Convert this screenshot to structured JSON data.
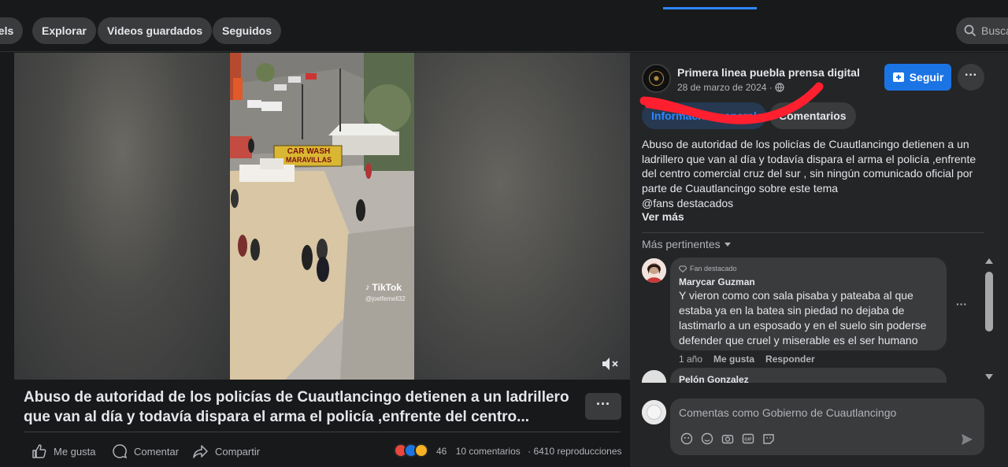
{
  "nav": {
    "tabs": [
      "eels",
      "Explorar",
      "Videos guardados",
      "Seguidos"
    ],
    "search_placeholder": "Busca"
  },
  "video": {
    "overlay": {
      "sign_line1": "CAR WASH",
      "sign_line2": "MARAVILLAS",
      "watermark": "TikTok",
      "watermark_user": "@joelfemell32"
    },
    "title": "Abuso de autoridad de los policías de Cuautlancingo detienen a un ladrillero que van al día y todavía dispara el arma el policía ,enfrente del centro...",
    "more_label": "···",
    "actions": {
      "like": "Me gusta",
      "comment": "Comentar",
      "share": "Compartir"
    },
    "stats": {
      "reactions_count": "46",
      "comments": "10 comentarios",
      "views": "6410 reproducciones"
    }
  },
  "post": {
    "page_name": "Primera linea puebla prensa digital",
    "date": "28 de marzo de 2024 ·",
    "follow_label": "Seguir",
    "more_label": "···",
    "tabs": {
      "info": "Información general",
      "comments": "Comentarios"
    },
    "description_lines": [
      "Abuso de autoridad de los policías de Cuautlancingo detienen a un",
      "ladrillero que van al día y todavía dispara el arma el policía ,enfrente",
      "del centro comercial cruz del sur , sin ningún comunicado oficial por",
      "parte de Cuautlancingo sobre este tema",
      "@fans destacados"
    ],
    "see_more": "Ver más"
  },
  "comments": {
    "sort_label": "Más pertinentes",
    "items": [
      {
        "badge": "Fan destacado",
        "author": "Marycar Guzman",
        "text_lines": [
          "Y vieron como con sala pisaba y pateaba al que",
          "estaba ya en la batea sin piedad no dejaba de",
          "lastimarlo a un esposado y en el suelo sin poderse",
          "defender que cruel y miserable es el ser humano"
        ],
        "time": "1 año",
        "like": "Me gusta",
        "reply": "Responder"
      },
      {
        "author": "Pelón Gonzalez"
      }
    ],
    "composer_placeholder": "Comentas como Gobierno de Cuautlancingo"
  },
  "colors": {
    "accent": "#1b74e4",
    "link_blue": "#2d88ff",
    "panel": "#242526",
    "background": "#18191a",
    "redaction": "#ff1f2e"
  }
}
